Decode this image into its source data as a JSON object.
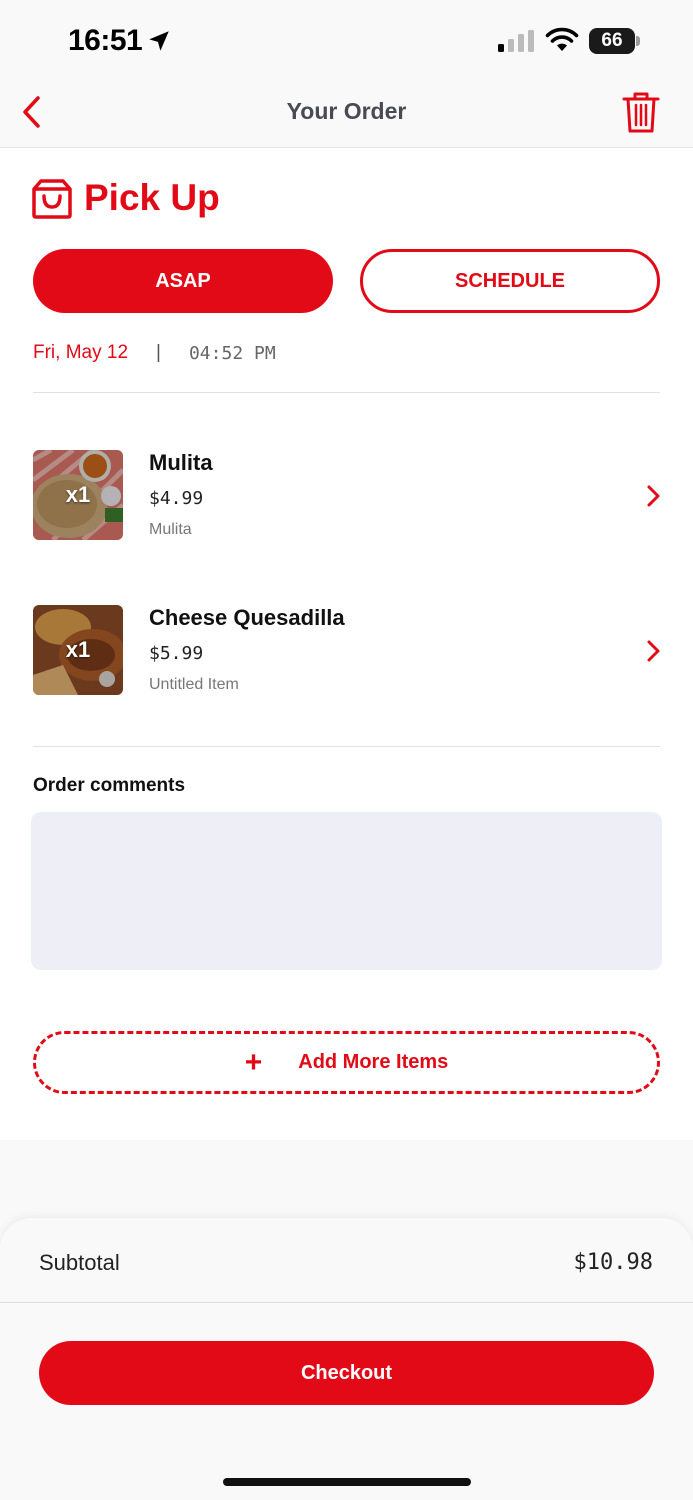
{
  "status_bar": {
    "time": "16:51",
    "battery": "66"
  },
  "nav": {
    "title": "Your Order"
  },
  "pickup": {
    "title": "Pick Up",
    "asap_label": "ASAP",
    "schedule_label": "SCHEDULE",
    "date": "Fri, May 12",
    "separator": "|",
    "time": "04:52 PM"
  },
  "items": [
    {
      "qty": "x1",
      "name": "Mulita",
      "price": "$4.99",
      "description": "Mulita"
    },
    {
      "qty": "x1",
      "name": "Cheese Quesadilla",
      "price": "$5.99",
      "description": "Untitled Item"
    }
  ],
  "comments": {
    "label": "Order comments",
    "value": ""
  },
  "add_more": {
    "plus": "+",
    "label": "Add More Items"
  },
  "summary": {
    "subtotal_label": "Subtotal",
    "subtotal_value": "$10.98"
  },
  "checkout_label": "Checkout",
  "colors": {
    "accent": "#e20a17",
    "comment_bg": "#eeeef6"
  }
}
